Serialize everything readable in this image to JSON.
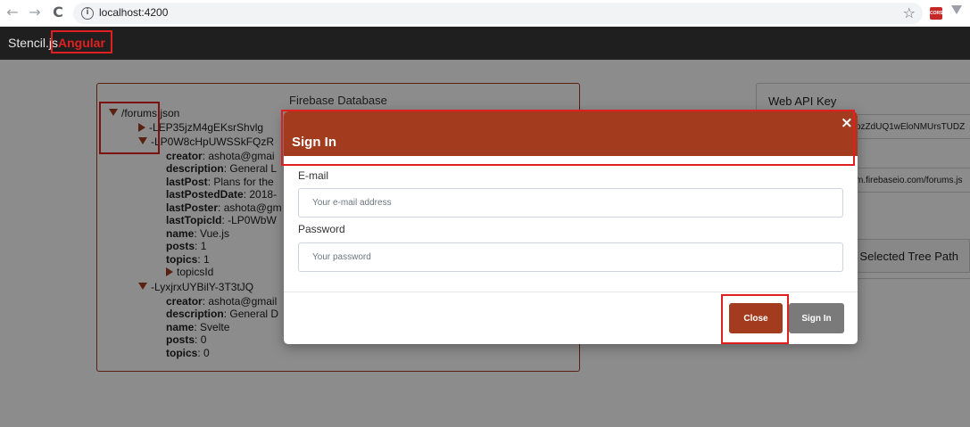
{
  "browser": {
    "url": "localhost:4200",
    "back_icon": "arrow-left-icon",
    "forward_icon": "arrow-right-icon",
    "reload_icon": "reload-icon",
    "info_glyph": "i",
    "back_glyph": "←",
    "forward_glyph": "→",
    "reload_glyph": "C",
    "star_glyph": "☆",
    "extension_label": "CORS"
  },
  "nav": {
    "stencil_label": "Stencil.js",
    "angular_label": "Angular"
  },
  "database": {
    "title": "Firebase Database",
    "tree": {
      "root": "/forums.json",
      "nodes": [
        {
          "key": "-LEP35jzM4gEKsrShvlg",
          "expanded": false
        },
        {
          "key": "-LP0W8cHpUWSSkFQzR",
          "expanded": true,
          "fields": [
            {
              "name": "creator",
              "value": "ashota@gmai"
            },
            {
              "name": "description",
              "value": "General L"
            },
            {
              "name": "lastPost",
              "value": "Plans for the"
            },
            {
              "name": "lastPostedDate",
              "value": "2018-"
            },
            {
              "name": "lastPoster",
              "value": "ashota@gm"
            },
            {
              "name": "lastTopicId",
              "value": "-LP0WbW"
            },
            {
              "name": "name",
              "value": "Vue.js"
            },
            {
              "name": "posts",
              "value": "1"
            },
            {
              "name": "topics",
              "value": "1"
            }
          ],
          "child": "topicsId"
        },
        {
          "key": "-LyxjrxUYBilY-3T3tJQ",
          "expanded": true,
          "fields": [
            {
              "name": "creator",
              "value": "ashota@gmail"
            },
            {
              "name": "description",
              "value": "General D"
            },
            {
              "name": "name",
              "value": "Svelte"
            },
            {
              "name": "posts",
              "value": "0"
            },
            {
              "name": "topics",
              "value": "0"
            }
          ]
        }
      ]
    }
  },
  "settings": {
    "api_key_label": "Web API Key",
    "api_key_value": "ozZdUQ1wEloNMUrsTUDZ",
    "db_url_value": "m.firebaseio.com/forums.js",
    "selected_tree_path_label": "Selected Tree Path"
  },
  "modal": {
    "title": "Sign In",
    "close_glyph": "×",
    "email_label": "E-mail",
    "email_placeholder": "Your e-mail address",
    "email_value": "",
    "password_label": "Password",
    "password_placeholder": "Your password",
    "password_value": "",
    "close_label": "Close",
    "signin_label": "Sign In"
  },
  "colors": {
    "primary": "#a33c1e",
    "annotation": "#e02020",
    "secondary_button": "#7a7a7a",
    "navbar": "#1f1f1f"
  }
}
